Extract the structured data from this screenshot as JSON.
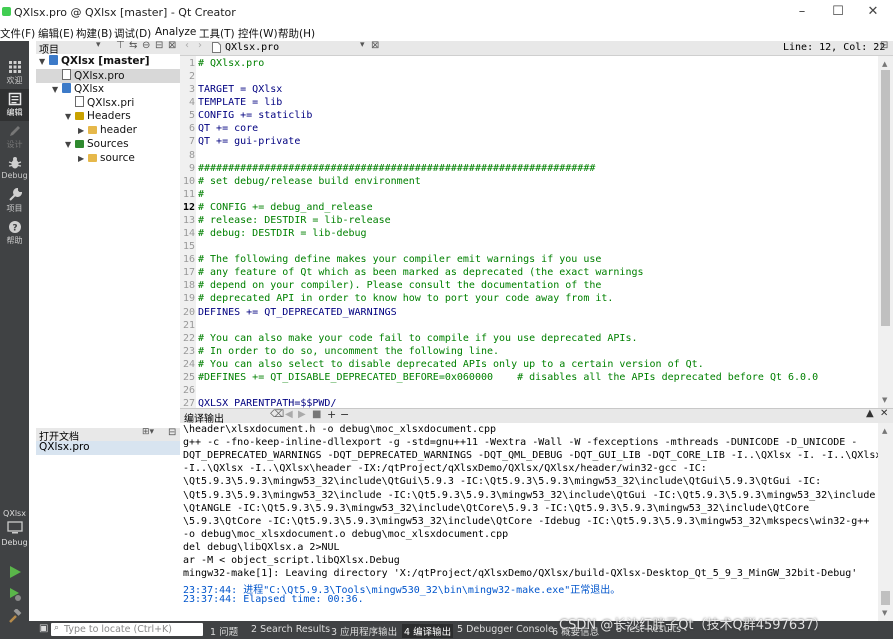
{
  "window": {
    "title": "QXlsx.pro @ QXlsx [master] - Qt Creator"
  },
  "menu": [
    "文件(F)",
    "编辑(E)",
    "构建(B)",
    "调试(D)",
    "Analyze",
    "工具(T)",
    "控件(W)",
    "帮助(H)"
  ],
  "modes": [
    {
      "label": "欢迎",
      "icon": "grid-icon"
    },
    {
      "label": "编辑",
      "icon": "edit-doc-icon",
      "active": true
    },
    {
      "label": "设计",
      "icon": "pencil-icon"
    },
    {
      "label": "Debug",
      "icon": "bug-icon"
    },
    {
      "label": "项目",
      "icon": "wrench-icon"
    },
    {
      "label": "帮助",
      "icon": "help-icon"
    }
  ],
  "bottom_modes": {
    "project": "QXlsx",
    "target": "Debug"
  },
  "project_panel": {
    "header": "项目",
    "tree": [
      {
        "label": "QXlsx [master]",
        "depth": 0,
        "arrow": "▼",
        "type": "project",
        "bold": true
      },
      {
        "label": "QXlsx.pro",
        "depth": 1,
        "arrow": "",
        "type": "pro",
        "selected": true
      },
      {
        "label": "QXlsx",
        "depth": 1,
        "arrow": "▼",
        "type": "project"
      },
      {
        "label": "QXlsx.pri",
        "depth": 2,
        "arrow": "",
        "type": "pri"
      },
      {
        "label": "Headers",
        "depth": 2,
        "arrow": "▼",
        "type": "hfolder"
      },
      {
        "label": "header",
        "depth": 3,
        "arrow": "▶",
        "type": "folder"
      },
      {
        "label": "Sources",
        "depth": 2,
        "arrow": "▼",
        "type": "sfolder"
      },
      {
        "label": "source",
        "depth": 3,
        "arrow": "▶",
        "type": "folder"
      }
    ]
  },
  "open_docs": {
    "header": "打开文档",
    "items": [
      "QXlsx.pro"
    ]
  },
  "editor": {
    "tab": "QXlsx.pro",
    "cursor": "Line: 12, Col: 22",
    "lines": [
      {
        "t": "# QXlsx.pro",
        "c": "cmt"
      },
      {
        "t": "",
        "c": ""
      },
      {
        "t": "TARGET = QXlsx",
        "c": "kw"
      },
      {
        "t": "TEMPLATE = lib",
        "c": "kw"
      },
      {
        "t": "CONFIG += staticlib",
        "c": "kw"
      },
      {
        "t": "QT += core",
        "c": "kw"
      },
      {
        "t": "QT += gui-private",
        "c": "kw"
      },
      {
        "t": "",
        "c": ""
      },
      {
        "t": "##################################################################",
        "c": "cmt"
      },
      {
        "t": "# set debug/release build environment",
        "c": "cmt"
      },
      {
        "t": "#",
        "c": "cmt"
      },
      {
        "t": "# CONFIG += debug_and_release",
        "c": "cmt"
      },
      {
        "t": "# release: DESTDIR = lib-release",
        "c": "cmt"
      },
      {
        "t": "# debug: DESTDIR = lib-debug",
        "c": "cmt"
      },
      {
        "t": "",
        "c": ""
      },
      {
        "t": "# The following define makes your compiler emit warnings if you use",
        "c": "cmt"
      },
      {
        "t": "# any feature of Qt which as been marked as deprecated (the exact warnings",
        "c": "cmt"
      },
      {
        "t": "# depend on your compiler). Please consult the documentation of the",
        "c": "cmt"
      },
      {
        "t": "# deprecated API in order to know how to port your code away from it.",
        "c": "cmt"
      },
      {
        "t": "DEFINES += QT_DEPRECATED_WARNINGS",
        "c": "kw"
      },
      {
        "t": "",
        "c": ""
      },
      {
        "t": "# You can also make your code fail to compile if you use deprecated APIs.",
        "c": "cmt"
      },
      {
        "t": "# In order to do so, uncomment the following line.",
        "c": "cmt"
      },
      {
        "t": "# You can also select to disable deprecated APIs only up to a certain version of Qt.",
        "c": "cmt"
      },
      {
        "t": "#DEFINES += QT_DISABLE_DEPRECATED_BEFORE=0x060000    # disables all the APIs deprecated before Qt 6.0.0",
        "c": "cmt"
      },
      {
        "t": "",
        "c": ""
      },
      {
        "t": "QXLSX_PARENTPATH=$$PWD/",
        "c": "kw"
      }
    ]
  },
  "output": {
    "header": "编译输出",
    "lines": [
      {
        "t": "\\header\\xlsxdocument.h -o debug\\moc_xlsxdocument.cpp",
        "c": ""
      },
      {
        "t": "g++ -c -fno-keep-inline-dllexport -g -std=gnu++11 -Wextra -Wall -W -fexceptions -mthreads -DUNICODE -D_UNICODE -",
        "c": ""
      },
      {
        "t": "DQT_DEPRECATED_WARNINGS -DQT_DEPRECATED_WARNINGS -DQT_QML_DEBUG -DQT_GUI_LIB -DQT_CORE_LIB -I..\\QXlsx -I. -I..\\QXlsx",
        "c": ""
      },
      {
        "t": "-I..\\QXlsx -I..\\QXlsx\\header -IX:/qtProject/qXlsxDemo/QXlsx/QXlsx/header/win32-gcc -IC:",
        "c": ""
      },
      {
        "t": "\\Qt5.9.3\\5.9.3\\mingw53_32\\include\\QtGui\\5.9.3 -IC:\\Qt5.9.3\\5.9.3\\mingw53_32\\include\\QtGui\\5.9.3\\QtGui -IC:",
        "c": ""
      },
      {
        "t": "\\Qt5.9.3\\5.9.3\\mingw53_32\\include -IC:\\Qt5.9.3\\5.9.3\\mingw53_32\\include\\QtGui -IC:\\Qt5.9.3\\5.9.3\\mingw53_32\\include",
        "c": ""
      },
      {
        "t": "\\QtANGLE -IC:\\Qt5.9.3\\5.9.3\\mingw53_32\\include\\QtCore\\5.9.3 -IC:\\Qt5.9.3\\5.9.3\\mingw53_32\\include\\QtCore",
        "c": ""
      },
      {
        "t": "\\5.9.3\\QtCore -IC:\\Qt5.9.3\\5.9.3\\mingw53_32\\include\\QtCore -Idebug -IC:\\Qt5.9.3\\5.9.3\\mingw53_32\\mkspecs\\win32-g++",
        "c": ""
      },
      {
        "t": "-o debug\\moc_xlsxdocument.o debug\\moc_xlsxdocument.cpp",
        "c": ""
      },
      {
        "t": "del debug\\libQXlsx.a 2>NUL",
        "c": ""
      },
      {
        "t": "ar -M < object_script.libQXlsx.Debug",
        "c": ""
      },
      {
        "t": "mingw32-make[1]: Leaving directory 'X:/qtProject/qXlsxDemo/QXlsx/build-QXlsx-Desktop_Qt_5_9_3_MinGW_32bit-Debug'",
        "c": ""
      },
      {
        "t": "23:37:44: 进程\"C:\\Qt5.9.3\\Tools\\mingw530_32\\bin\\mingw32-make.exe\"正常退出。",
        "c": "blue"
      },
      {
        "t": "23:37:44: Elapsed time: 00:36.",
        "c": "blue"
      }
    ]
  },
  "statusbar": {
    "locate_placeholder": "Type to locate (Ctrl+K)",
    "tabs": [
      "1 问题",
      "2 Search Results",
      "3 应用程序输出",
      "4 编译输出",
      "5 Debugger Console",
      "6 概要信息",
      "8 Test Results"
    ],
    "watermark": "CSDN @长沙红胖子Qt（技术Q群4597637）"
  }
}
